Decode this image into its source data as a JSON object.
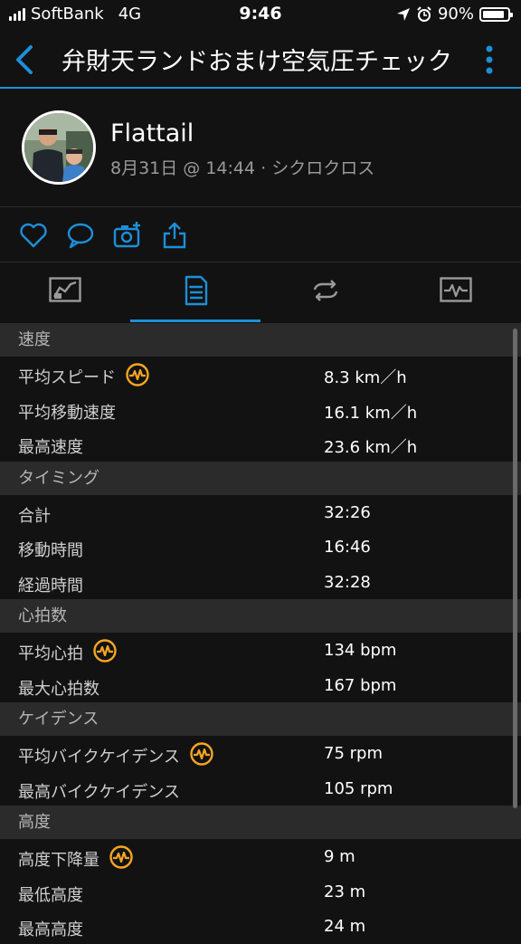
{
  "status": {
    "carrier": "SoftBank",
    "network": "4G",
    "time": "9:46",
    "battery": "90%",
    "battery_level": 0.9
  },
  "nav": {
    "title": "弁財天ランドおまけ空気圧チェック"
  },
  "activity": {
    "author": "Flattail",
    "meta": "8月31日 @ 14:44 · シクロクロス"
  },
  "accent_color": "#1d8fd8",
  "badge_color": "#f5a623",
  "sections": [
    {
      "title": "速度",
      "rows": [
        {
          "label": "平均スピード",
          "value": "8.3 km／h",
          "badge": true
        },
        {
          "label": "平均移動速度",
          "value": "16.1 km／h",
          "badge": false
        },
        {
          "label": "最高速度",
          "value": "23.6 km／h",
          "badge": false
        }
      ]
    },
    {
      "title": "タイミング",
      "rows": [
        {
          "label": "合計",
          "value": "32:26",
          "badge": false
        },
        {
          "label": "移動時間",
          "value": "16:46",
          "badge": false
        },
        {
          "label": "経過時間",
          "value": "32:28",
          "badge": false
        }
      ]
    },
    {
      "title": "心拍数",
      "rows": [
        {
          "label": "平均心拍",
          "value": "134 bpm",
          "badge": true
        },
        {
          "label": "最大心拍数",
          "value": "167 bpm",
          "badge": false
        }
      ]
    },
    {
      "title": "ケイデンス",
      "rows": [
        {
          "label": "平均バイクケイデンス",
          "value": "75 rpm",
          "badge": true
        },
        {
          "label": "最高バイクケイデンス",
          "value": "105 rpm",
          "badge": false
        }
      ]
    },
    {
      "title": "高度",
      "rows": [
        {
          "label": "高度下降量",
          "value": "9 m",
          "badge": true
        },
        {
          "label": "最低高度",
          "value": "23 m",
          "badge": false
        },
        {
          "label": "最高高度",
          "value": "24 m",
          "badge": false
        }
      ]
    }
  ]
}
